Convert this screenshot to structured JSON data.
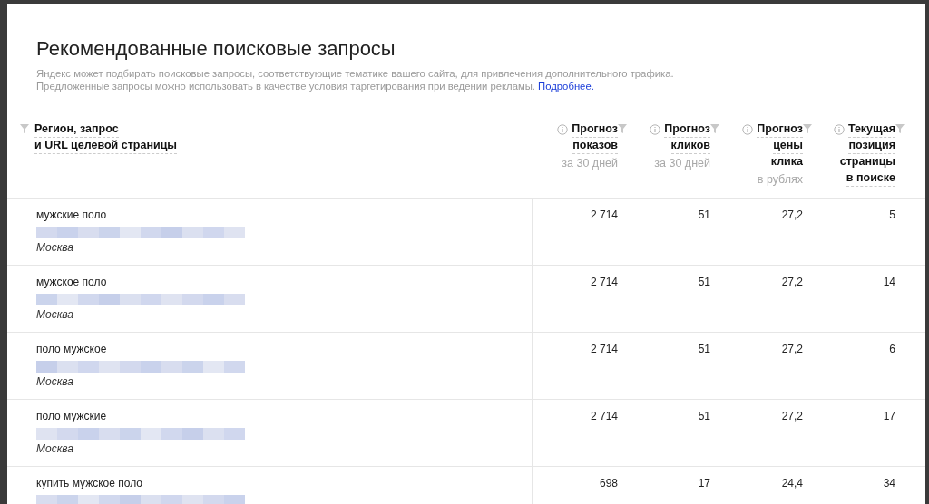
{
  "title": "Рекомендованные поисковые запросы",
  "description": "Яндекс может подбирать поисковые запросы, соответствующие тематике вашего сайта, для привлечения дополнительного трафика.",
  "description_2": "Предложенные запросы можно использовать в качестве условия таргетирования при ведении рекламы.",
  "more_link": "Подробнее.",
  "first_column": {
    "lines": [
      "Регион, запрос",
      "и URL целевой страницы"
    ]
  },
  "columns": [
    {
      "lines": [
        "Прогноз",
        "показов"
      ],
      "note": "за 30 дней"
    },
    {
      "lines": [
        "Прогноз",
        "кликов"
      ],
      "note": "за 30 дней"
    },
    {
      "lines": [
        "Прогноз",
        "цены",
        "клика"
      ],
      "note": "в рублях"
    },
    {
      "lines": [
        "Текущая",
        "позиция",
        "страницы",
        "в поиске"
      ]
    }
  ],
  "rows": [
    {
      "query": "мужские поло",
      "url_hidden": true,
      "region": "Москва",
      "values": [
        "2 714",
        "51",
        "27,2",
        "5"
      ]
    },
    {
      "query": "мужское поло",
      "url_hidden": true,
      "region": "Москва",
      "values": [
        "2 714",
        "51",
        "27,2",
        "14"
      ]
    },
    {
      "query": "поло мужское",
      "url_hidden": true,
      "region": "Москва",
      "values": [
        "2 714",
        "51",
        "27,2",
        "6"
      ]
    },
    {
      "query": "поло мужские",
      "url_hidden": true,
      "region": "Москва",
      "values": [
        "2 714",
        "51",
        "27,2",
        "17"
      ]
    },
    {
      "query": "купить мужское поло",
      "url_hidden": true,
      "values": [
        "698",
        "17",
        "24,4",
        "34"
      ]
    }
  ]
}
